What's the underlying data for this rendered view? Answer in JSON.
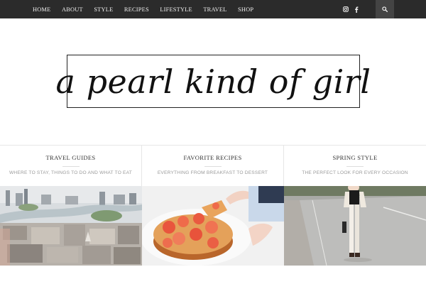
{
  "nav": {
    "items": [
      "HOME",
      "ABOUT",
      "STYLE",
      "RECIPES",
      "LIFESTYLE",
      "TRAVEL",
      "SHOP"
    ]
  },
  "social": {
    "instagram_icon": "instagram-icon",
    "facebook_icon": "facebook-icon",
    "search_icon": "search-icon"
  },
  "logo": {
    "text": "a pearl kind of girl"
  },
  "promos": [
    {
      "title": "TRAVEL GUIDES",
      "subtitle": "WHERE TO STAY, THINGS TO DO AND WHAT TO EAT"
    },
    {
      "title": "FAVORITE RECIPES",
      "subtitle": "EVERYTHING FROM BREAKFAST TO DESSERT"
    },
    {
      "title": "SPRING STYLE",
      "subtitle": "THE PERFECT LOOK FOR EVERY OCCASION"
    }
  ],
  "colors": {
    "topbar": "#2b2b2b",
    "search_box": "#444444",
    "accent_text": "#333333",
    "subtitle_text": "#9a9a9a"
  }
}
